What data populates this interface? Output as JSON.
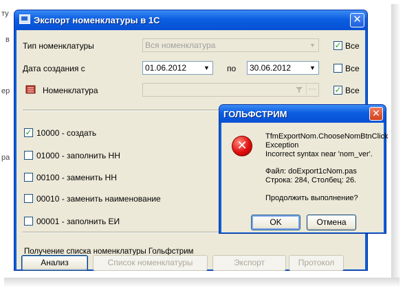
{
  "background": {
    "fragments": [
      "ту",
      "в",
      "ер",
      "ра"
    ]
  },
  "main_dialog": {
    "title": "Экспорт номенклатуры в 1С",
    "close_glyph": "✕",
    "type_label": "Тип номенклатуры",
    "type_value": "Вся номенклатура",
    "type_all_label": "Все",
    "type_all_checked": true,
    "date_label": "Дата создания  с",
    "date_from": "01.06.2012",
    "date_to_label": "по",
    "date_to": "30.06.2012",
    "date_all_label": "Все",
    "date_all_checked": false,
    "nomenclature_label": "Номенклатура",
    "nomenclature_value": "",
    "nomenclature_all_label": "Все",
    "nomenclature_all_checked": true,
    "options": [
      {
        "label": "10000 - создать",
        "checked": true
      },
      {
        "label": "01000 - заполнить НН",
        "checked": false
      },
      {
        "label": "00100 - заменить НН",
        "checked": false
      },
      {
        "label": "00010 - заменить наименование",
        "checked": false
      },
      {
        "label": "00001 - заполнить ЕИ",
        "checked": false
      }
    ],
    "status_text": "Получение списка номенклатуры Гольфстрим",
    "buttons": {
      "analyze": "Анализ",
      "list": "Список номенклатуры",
      "export": "Экспорт",
      "protocol": "Протокол"
    }
  },
  "error_dialog": {
    "title": "ГОЛЬФСТРИМ",
    "close_glyph": "✕",
    "icon": "error-x-icon",
    "lines": {
      "l1": "TfmExportNom.ChooseNomBtnClick",
      "l2": "Exception",
      "l3": "Incorrect syntax near 'nom_ver'.",
      "l4": "Файл: doExport1cNom.pas",
      "l5": "Строка: 284, Столбец: 26.",
      "l6": "Продолжить выполнение?"
    },
    "ok_label": "OK",
    "cancel_label": "Отмена"
  },
  "colors": {
    "titlebar": "#0d5ee1",
    "face": "#ece9d8",
    "error_red": "#e01010"
  }
}
